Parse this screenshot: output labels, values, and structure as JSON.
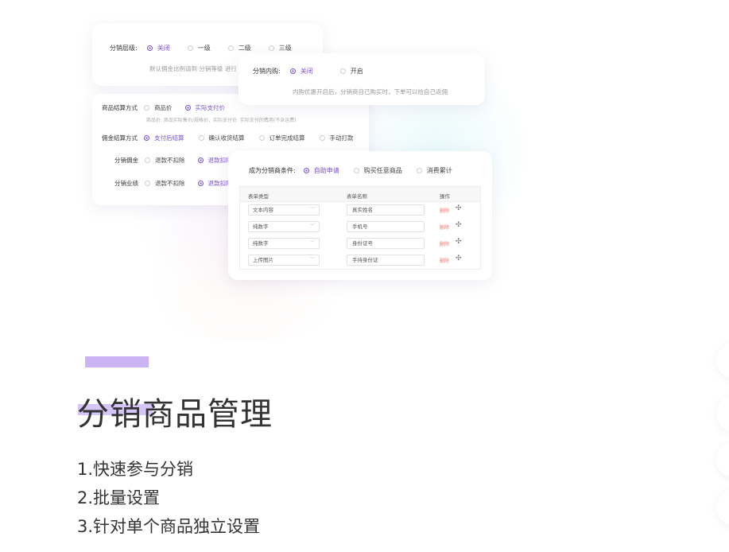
{
  "card_level": {
    "label": "分销层级:",
    "options": [
      "关闭",
      "一级",
      "二级",
      "三级"
    ],
    "selected": "关闭",
    "note": "默认佣金比例请到 分销等级 进行"
  },
  "card_internal": {
    "label": "分销内购:",
    "options": [
      "关闭",
      "开启"
    ],
    "selected": "关闭",
    "note": "内购优惠开启后，分销商自己购买时，下单可以给自己返佣"
  },
  "card_settle": {
    "product_settle": {
      "label": "商品结算方式",
      "options": [
        "商品价",
        "实际支付价"
      ],
      "selected": "实际支付价",
      "note": "商品价: 商品实际售价/规格价、实际支付价: 实际支付的费用(不含运费)"
    },
    "commission_settle": {
      "label": "佣金结算方式",
      "options": [
        "支付后结算",
        "确认收货结算",
        "订单完成结算",
        "手动打款"
      ],
      "selected": "支付后结算"
    },
    "commission": {
      "label": "分销佣金",
      "options": [
        "退款不扣除",
        "退款扣除"
      ],
      "selected": "退款扣除"
    },
    "performance": {
      "label": "分销业绩",
      "options": [
        "退款不扣除",
        "退款扣除"
      ],
      "selected": "退款扣除"
    }
  },
  "card_condition": {
    "label": "成为分销商条件:",
    "options": [
      "自助申请",
      "购买任意商品",
      "消费累计"
    ],
    "selected": "自助申请",
    "table": {
      "headers": [
        "表单类型",
        "表单名称",
        "操作"
      ],
      "rows": [
        {
          "type": "文本内容",
          "name": "真实姓名",
          "delete": "删除"
        },
        {
          "type": "纯数字",
          "name": "手机号",
          "delete": "删除"
        },
        {
          "type": "纯数字",
          "name": "身份证号",
          "delete": "删除"
        },
        {
          "type": "上传图片",
          "name": "手持身份证",
          "delete": "删除"
        }
      ]
    }
  },
  "section": {
    "title": "分销商品管理",
    "features": [
      "1.快速参与分销",
      "2.批量设置",
      "3.针对单个商品独立设置"
    ]
  },
  "colors": {
    "accent": "#7b4fd6",
    "accent_bar": "#cbb4f5",
    "delete": "#e9776d"
  },
  "icons": {
    "move": "move-cross-icon",
    "dropdown": "chevron-down-icon"
  }
}
